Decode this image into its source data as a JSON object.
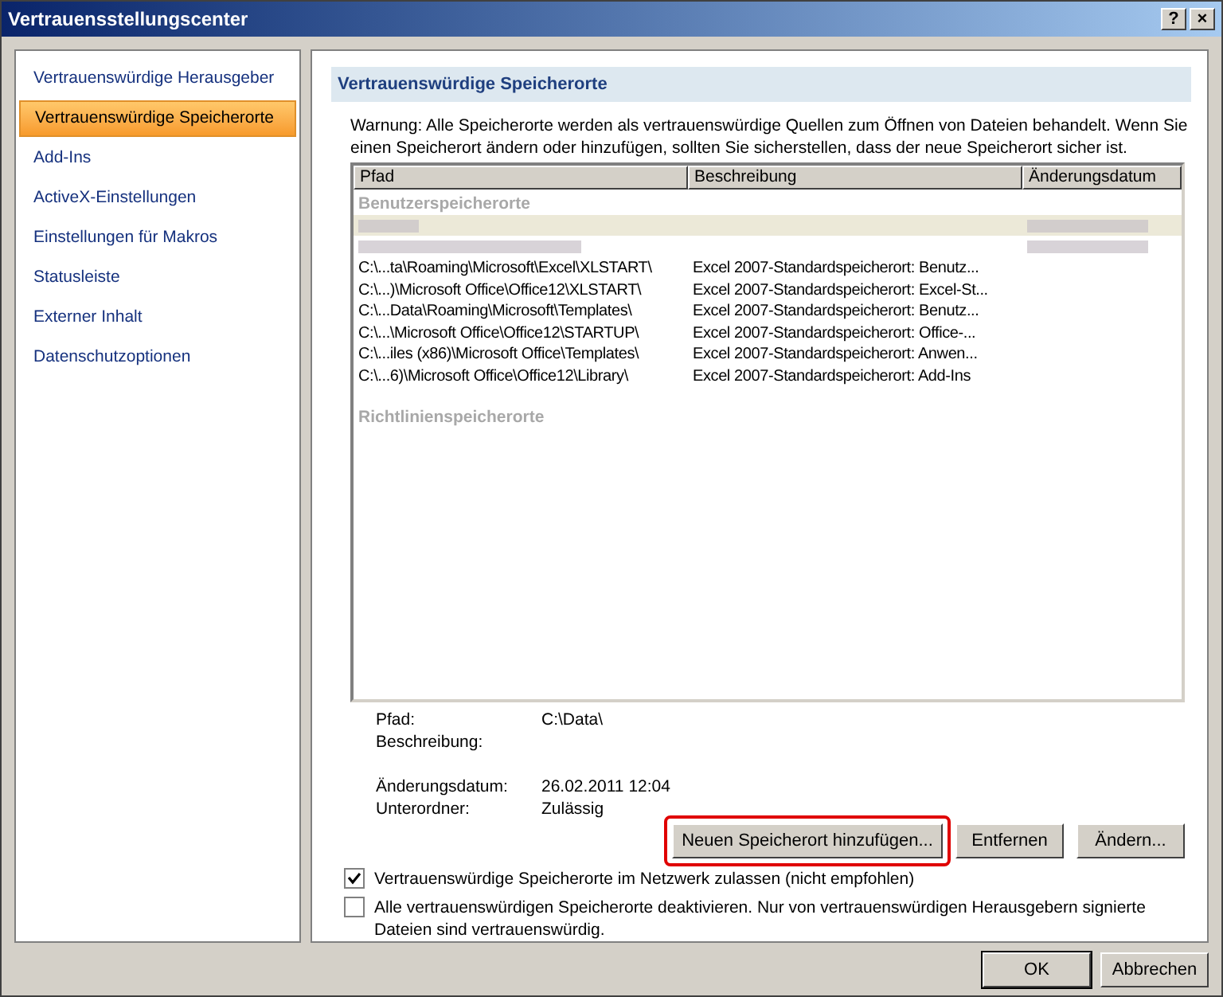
{
  "window": {
    "title": "Vertrauensstellungscenter",
    "controls": [
      "?",
      "×"
    ]
  },
  "sidebar": {
    "items": [
      {
        "label": "Vertrauenswürdige Herausgeber",
        "selected": false
      },
      {
        "label": "Vertrauenswürdige Speicherorte",
        "selected": true
      },
      {
        "label": "Add-Ins",
        "selected": false
      },
      {
        "label": "ActiveX-Einstellungen",
        "selected": false
      },
      {
        "label": "Einstellungen für Makros",
        "selected": false
      },
      {
        "label": "Statusleiste",
        "selected": false
      },
      {
        "label": "Externer Inhalt",
        "selected": false
      },
      {
        "label": "Datenschutzoptionen",
        "selected": false
      }
    ]
  },
  "section_title": "Vertrauenswürdige Speicherorte",
  "warning": "Warnung: Alle Speicherorte werden als vertrauenswürdige Quellen zum Öffnen von Dateien behandelt. Wenn Sie einen Speicherort ändern oder hinzufügen, sollten Sie sicherstellen, dass der neue Speicherort sicher ist.",
  "table": {
    "columns": [
      "Pfad",
      "Beschreibung",
      "Änderungsdatum"
    ],
    "groups": [
      {
        "label": "Benutzerspeicherorte",
        "rows": [
          {
            "kind": "redacted",
            "selected": true
          },
          {
            "kind": "redacted",
            "selected": false
          },
          {
            "kind": "text",
            "selected": false,
            "cells": [
              "C:\\...ta\\Roaming\\Microsoft\\Excel\\XLSTART\\",
              "Excel 2007-Standardspeicherort: Benutz..."
            ]
          },
          {
            "kind": "text",
            "selected": false,
            "cells": [
              "C:\\...)\\Microsoft Office\\Office12\\XLSTART\\",
              "Excel 2007-Standardspeicherort: Excel-St..."
            ]
          },
          {
            "kind": "text",
            "selected": false,
            "cells": [
              "C:\\...Data\\Roaming\\Microsoft\\Templates\\",
              "Excel 2007-Standardspeicherort: Benutz..."
            ]
          },
          {
            "kind": "text",
            "selected": false,
            "cells": [
              "C:\\...\\Microsoft Office\\Office12\\STARTUP\\",
              "Excel 2007-Standardspeicherort: Office-..."
            ]
          },
          {
            "kind": "text",
            "selected": false,
            "cells": [
              "C:\\...iles (x86)\\Microsoft Office\\Templates\\",
              "Excel 2007-Standardspeicherort: Anwen..."
            ]
          },
          {
            "kind": "text",
            "selected": false,
            "cells": [
              "C:\\...6)\\Microsoft Office\\Office12\\Library\\",
              "Excel 2007-Standardspeicherort: Add-Ins"
            ]
          }
        ]
      },
      {
        "label": "Richtlinienspeicherorte"
      }
    ]
  },
  "details": [
    [
      {
        "label": "Pfad:",
        "value": "C:\\Data\\"
      },
      {
        "label": "Beschreibung:"
      }
    ],
    [
      {
        "label": "Änderungsdatum:",
        "value": "26.02.2011 12:04"
      },
      {
        "label": "Unterordner:",
        "value": "Zulässig"
      }
    ]
  ],
  "actions": [
    {
      "label": "Neuen Speicherort hinzufügen...",
      "highlighted": true
    },
    {
      "label": "Entfernen",
      "highlighted": false
    },
    {
      "label": "Ändern...",
      "highlighted": false
    }
  ],
  "options": [
    {
      "label": "Vertrauenswürdige Speicherorte im Netzwerk zulassen (nicht empfohlen)",
      "checked": true
    },
    {
      "label": "Alle vertrauenswürdigen Speicherorte deaktivieren. Nur von vertrauenswürdigen Herausgebern signierte Dateien sind vertrauenswürdig.",
      "checked": false
    }
  ],
  "footer_buttons": [
    {
      "label": "OK",
      "default": true
    },
    {
      "label": "Abbrechen",
      "default": false
    }
  ]
}
